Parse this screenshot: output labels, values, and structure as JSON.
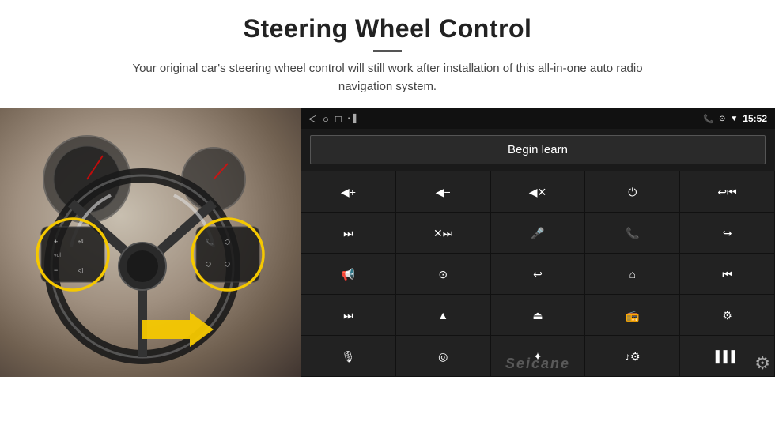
{
  "header": {
    "title": "Steering Wheel Control",
    "subtitle": "Your original car's steering wheel control will still work after installation of this all-in-one auto radio navigation system."
  },
  "status_bar": {
    "time": "15:52",
    "nav_back": "◁",
    "nav_home": "○",
    "nav_square": "□",
    "phone_icon": "📞",
    "location_icon": "⊙",
    "wifi_icon": "▼"
  },
  "begin_learn_btn": "Begin learn",
  "icon_grid": [
    {
      "id": "vol-up",
      "symbol": "🔊+"
    },
    {
      "id": "vol-down",
      "symbol": "🔊−"
    },
    {
      "id": "mute",
      "symbol": "🔇"
    },
    {
      "id": "power",
      "symbol": "⏻"
    },
    {
      "id": "phone-prev",
      "symbol": "📞⏮"
    },
    {
      "id": "skip-next",
      "symbol": "⏭"
    },
    {
      "id": "ff-skip",
      "symbol": "⏩"
    },
    {
      "id": "mic",
      "symbol": "🎤"
    },
    {
      "id": "phone",
      "symbol": "📞"
    },
    {
      "id": "hang-up",
      "symbol": "↩"
    },
    {
      "id": "speaker",
      "symbol": "📢"
    },
    {
      "id": "360-cam",
      "symbol": "360°"
    },
    {
      "id": "back-nav",
      "symbol": "↩"
    },
    {
      "id": "home-nav",
      "symbol": "⌂"
    },
    {
      "id": "rewind",
      "symbol": "⏮"
    },
    {
      "id": "skip-fwd",
      "symbol": "⏭"
    },
    {
      "id": "navigate",
      "symbol": "▶"
    },
    {
      "id": "eject",
      "symbol": "⏏"
    },
    {
      "id": "radio",
      "symbol": "📻"
    },
    {
      "id": "equalizer",
      "symbol": "⚙"
    },
    {
      "id": "mic2",
      "symbol": "🎙"
    },
    {
      "id": "settings2",
      "symbol": "⚙"
    },
    {
      "id": "bluetooth",
      "symbol": "✦"
    },
    {
      "id": "music",
      "symbol": "🎵"
    },
    {
      "id": "spectrum",
      "symbol": "📊"
    }
  ],
  "watermark": "Seicane",
  "gear_icon": "⚙"
}
